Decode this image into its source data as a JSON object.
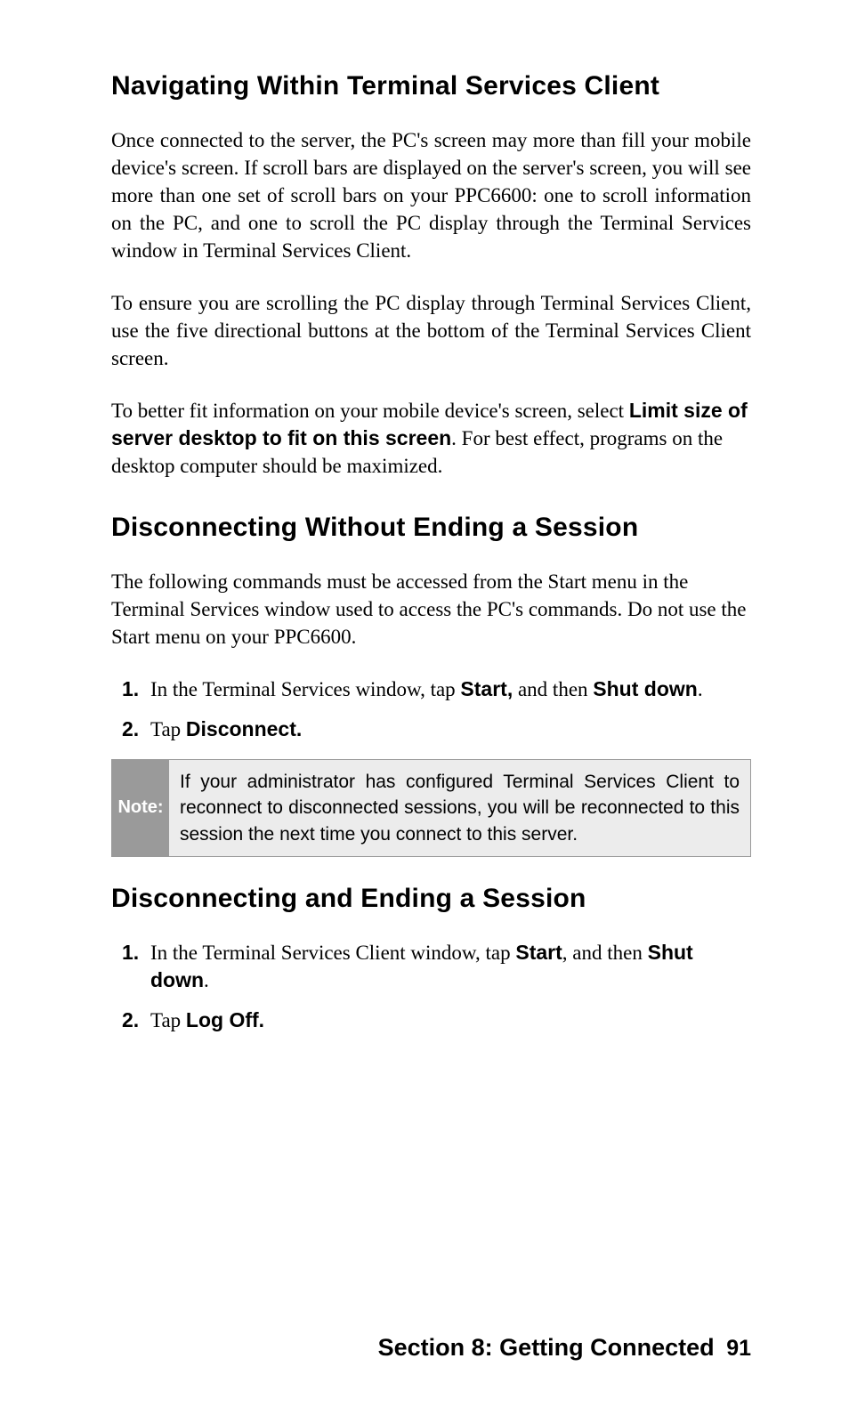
{
  "sections": {
    "nav": {
      "heading": "Navigating Within Terminal Services Client",
      "p1": "Once connected to the server, the PC's screen may more than fill your mobile device's screen. If scroll bars are displayed on the server's screen, you will see more than one set of scroll bars on your PPC6600: one to scroll information on the PC, and one to scroll the PC display through the Terminal Services window in Terminal Services Client.",
      "p2": "To ensure you are scrolling the PC display through Terminal Services Client, use the five directional buttons at the bottom of the Terminal Services Client screen.",
      "p3a": "To better fit information on your mobile device's screen, select ",
      "p3bold": "Limit size of server desktop to fit on this screen",
      "p3b": ". For best effect, programs on the desktop computer should be maximized."
    },
    "discNoEnd": {
      "heading": "Disconnecting Without Ending a Session",
      "intro": "The following commands must be accessed from the Start menu in the Terminal Services window used to access the PC's commands. Do not use the Start menu on your PPC6600.",
      "steps": {
        "s1a": " In the Terminal Services window, tap ",
        "s1b1": "Start,",
        "s1c": " and then ",
        "s1b2": "Shut down",
        "s1d": ".",
        "s2a": "Tap ",
        "s2b": "Disconnect."
      },
      "note": {
        "label": "Note:",
        "text": "If your administrator has configured Terminal Services Client to reconnect to disconnected sessions, you will be reconnected to this session the next time you connect to this server."
      }
    },
    "discEnd": {
      "heading": "Disconnecting and Ending a Session",
      "steps": {
        "s1a": "In the Terminal Services Client window, tap ",
        "s1b1": "Start",
        "s1c": ", and then ",
        "s1b2": "Shut down",
        "s1d": ".",
        "s2a": "Tap ",
        "s2b": "Log Off."
      }
    }
  },
  "footer": {
    "section": "Section 8: Getting Connected",
    "page": "91"
  }
}
